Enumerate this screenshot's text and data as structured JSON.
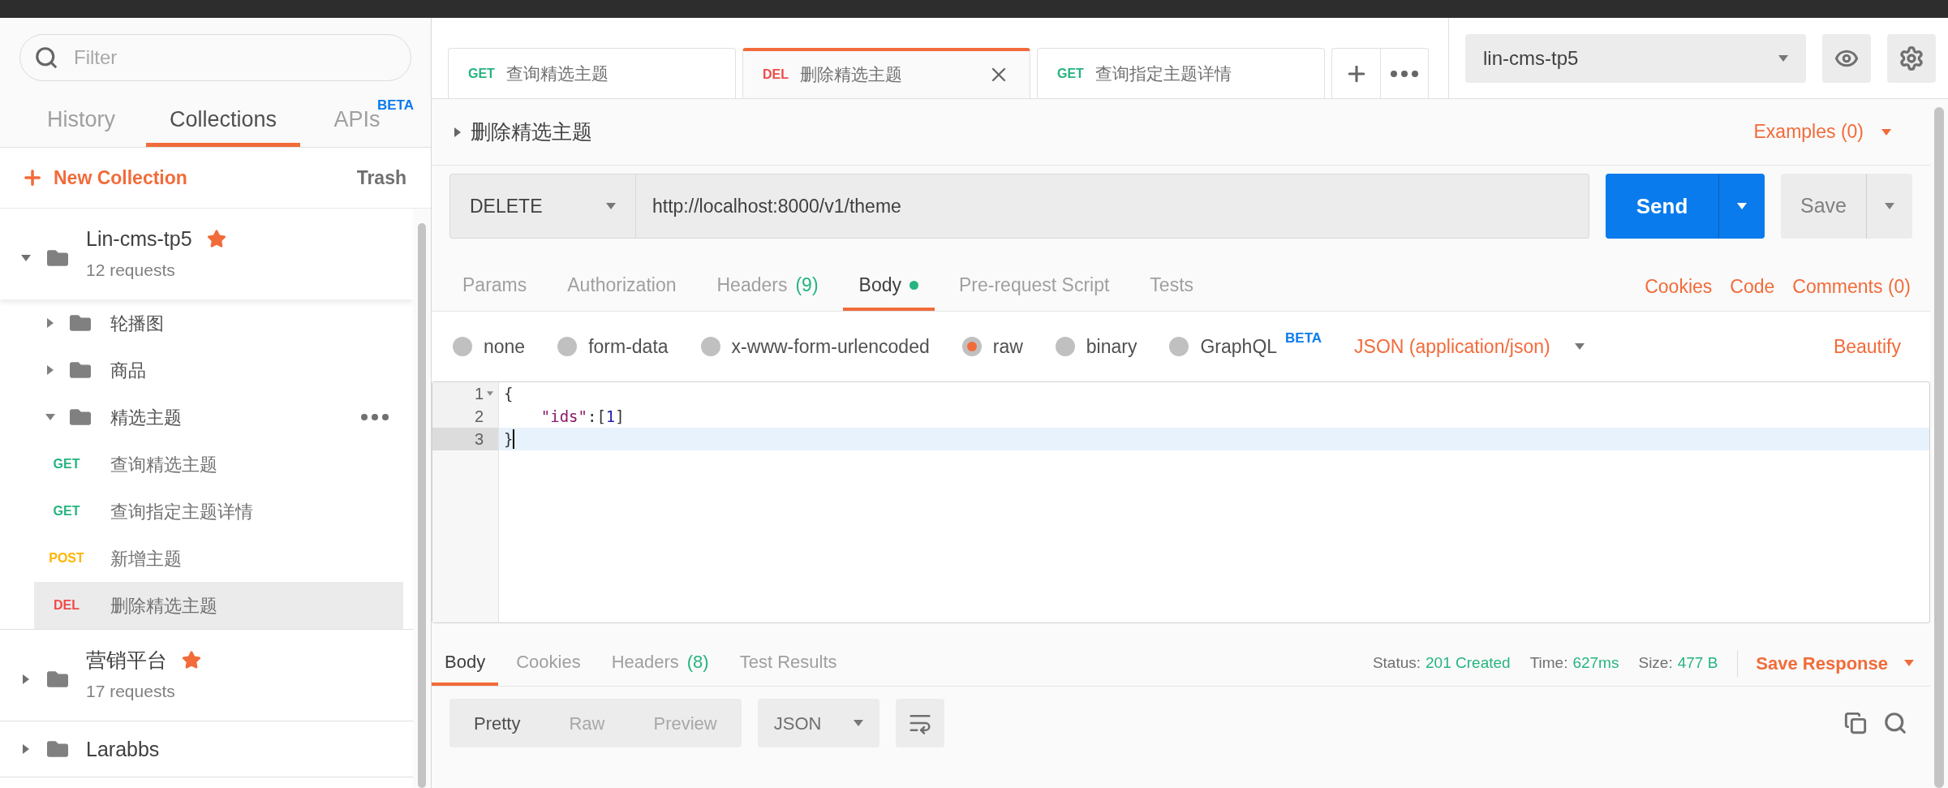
{
  "sidebar": {
    "filter": {
      "placeholder": "Filter"
    },
    "tabs": [
      {
        "label": "History",
        "selected": false
      },
      {
        "label": "Collections",
        "selected": true
      },
      {
        "label": "APIs",
        "badge": "BETA",
        "selected": false
      }
    ],
    "new_collection": "New Collection",
    "trash": "Trash",
    "collections": [
      {
        "name": "Lin-cms-tp5",
        "starred": true,
        "count": "12 requests",
        "expanded": true,
        "children": [
          {
            "kind": "folder",
            "name": "轮播图",
            "expanded": false,
            "selected": false
          },
          {
            "kind": "folder",
            "name": "商品",
            "expanded": false,
            "selected": false
          },
          {
            "kind": "folder",
            "name": "精选主题",
            "expanded": true,
            "selected": false,
            "children": [
              {
                "kind": "request",
                "method": "GET",
                "color": "#26b47f",
                "name": "查询精选主题",
                "selected": false
              },
              {
                "kind": "request",
                "method": "GET",
                "color": "#26b47f",
                "name": "查询指定主题详情",
                "selected": false
              },
              {
                "kind": "request",
                "method": "POST",
                "color": "#ffb400",
                "name": "新增主题",
                "selected": false
              },
              {
                "kind": "request",
                "method": "DEL",
                "color": "#ed4b48",
                "name": "删除精选主题",
                "selected": true
              }
            ]
          }
        ]
      },
      {
        "name": "营销平台",
        "starred": true,
        "count": "17 requests",
        "expanded": false
      },
      {
        "name": "Larabbs",
        "starred": false,
        "expanded": false
      }
    ]
  },
  "request_tabs": [
    {
      "method": "GET",
      "color": "#26b47f",
      "name": "查询精选主题",
      "selected": false
    },
    {
      "method": "DEL",
      "color": "#ed4b48",
      "name": "删除精选主题",
      "selected": true
    },
    {
      "method": "GET",
      "color": "#26b47f",
      "name": "查询指定主题详情",
      "selected": false
    }
  ],
  "environment": {
    "value": "lin-cms-tp5"
  },
  "request": {
    "name": "删除精选主题",
    "examples": "Examples (0)",
    "method": "DELETE",
    "url": "http://localhost:8000/v1/theme",
    "send": "Send",
    "save": "Save"
  },
  "request_sections": {
    "tabs": [
      {
        "label": "Params",
        "selected": false
      },
      {
        "label": "Authorization",
        "selected": false
      },
      {
        "label": "Headers",
        "count": "(9)",
        "selected": false
      },
      {
        "label": "Body",
        "dot": true,
        "selected": true
      },
      {
        "label": "Pre-request Script",
        "selected": false
      },
      {
        "label": "Tests",
        "selected": false
      }
    ],
    "links": [
      "Cookies",
      "Code",
      "Comments (0)"
    ]
  },
  "body_modes": [
    {
      "label": "none",
      "selected": false
    },
    {
      "label": "form-data",
      "selected": false
    },
    {
      "label": "x-www-form-urlencoded",
      "selected": false
    },
    {
      "label": "raw",
      "selected": true
    },
    {
      "label": "binary",
      "selected": false
    },
    {
      "label": "GraphQL",
      "badge": "BETA",
      "selected": false
    }
  ],
  "body_format": "JSON (application/json)",
  "beautify": "Beautify",
  "editor": {
    "lines": [
      {
        "number": "1",
        "foldable": true,
        "selected": false,
        "tokens": [
          {
            "kind": "punct",
            "text": "{"
          }
        ]
      },
      {
        "number": "2",
        "foldable": false,
        "selected": false,
        "tokens": [
          {
            "kind": "key",
            "text": "\"ids\""
          },
          {
            "kind": "punct",
            "text": ":["
          },
          {
            "kind": "number",
            "text": "1"
          },
          {
            "kind": "punct",
            "text": "]"
          }
        ]
      },
      {
        "number": "3",
        "foldable": false,
        "selected": true,
        "tokens": [
          {
            "kind": "punct",
            "text": "}"
          }
        ]
      }
    ]
  },
  "response": {
    "tabs": [
      {
        "label": "Body",
        "selected": true
      },
      {
        "label": "Cookies",
        "selected": false
      },
      {
        "label": "Headers",
        "count": "(8)",
        "selected": false
      },
      {
        "label": "Test Results",
        "selected": false
      }
    ],
    "status": [
      {
        "label": "Status:",
        "value": "201 Created"
      },
      {
        "label": "Time:",
        "value": "627ms"
      },
      {
        "label": "Size:",
        "value": "477 B"
      }
    ],
    "save_response": "Save Response",
    "views": [
      {
        "label": "Pretty",
        "selected": true
      },
      {
        "label": "Raw",
        "selected": false
      },
      {
        "label": "Preview",
        "selected": false
      }
    ],
    "format": "JSON"
  }
}
